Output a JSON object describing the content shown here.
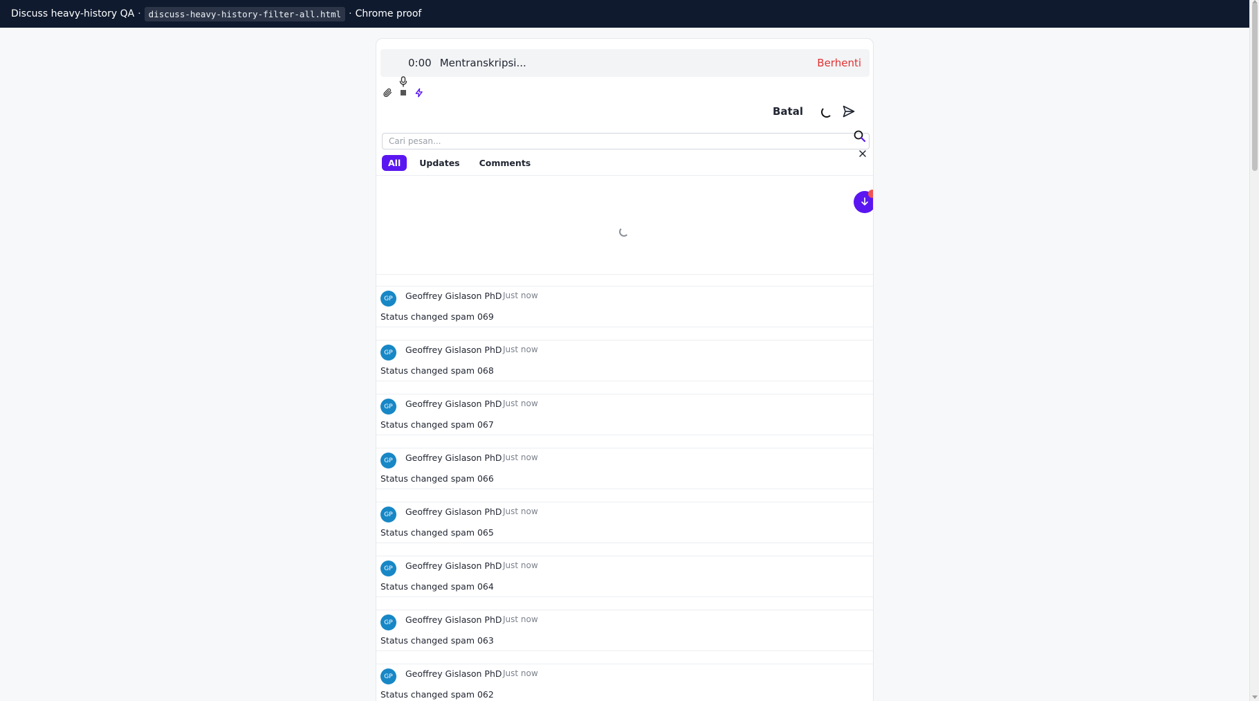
{
  "topbar": {
    "title": "Discuss heavy-history QA",
    "file": "discuss-heavy-history-filter-all.html",
    "suffix": "Chrome proof",
    "separator": "·"
  },
  "recorder": {
    "timer": "0:00",
    "status": "Mentranskripsi...",
    "stop_label": "Berhenti"
  },
  "composer": {
    "cancel_label": "Batal",
    "tools": [
      "paperclip-icon",
      "microphone-icon",
      "lightning-icon"
    ],
    "send_icon": "send-icon"
  },
  "search": {
    "placeholder": "Cari pesan...",
    "value": ""
  },
  "filter_tabs": [
    {
      "label": "All",
      "active": true
    },
    {
      "label": "Updates",
      "active": false
    },
    {
      "label": "Comments",
      "active": false
    }
  ],
  "colors": {
    "accent": "#5a16f0",
    "avatar": "#1787c6",
    "stop": "#e03131",
    "badge": "#ef5350",
    "topbar": "#0f1a2e"
  },
  "messages": [
    {
      "initials": "GP",
      "author": "Geoffrey Gislason PhD",
      "time": "Just now",
      "text": "Status changed spam 069"
    },
    {
      "initials": "GP",
      "author": "Geoffrey Gislason PhD",
      "time": "Just now",
      "text": "Status changed spam 068"
    },
    {
      "initials": "GP",
      "author": "Geoffrey Gislason PhD",
      "time": "Just now",
      "text": "Status changed spam 067"
    },
    {
      "initials": "GP",
      "author": "Geoffrey Gislason PhD",
      "time": "Just now",
      "text": "Status changed spam 066"
    },
    {
      "initials": "GP",
      "author": "Geoffrey Gislason PhD",
      "time": "Just now",
      "text": "Status changed spam 065"
    },
    {
      "initials": "GP",
      "author": "Geoffrey Gislason PhD",
      "time": "Just now",
      "text": "Status changed spam 064"
    },
    {
      "initials": "GP",
      "author": "Geoffrey Gislason PhD",
      "time": "Just now",
      "text": "Status changed spam 063"
    },
    {
      "initials": "GP",
      "author": "Geoffrey Gislason PhD",
      "time": "Just now",
      "text": "Status changed spam 062"
    }
  ]
}
